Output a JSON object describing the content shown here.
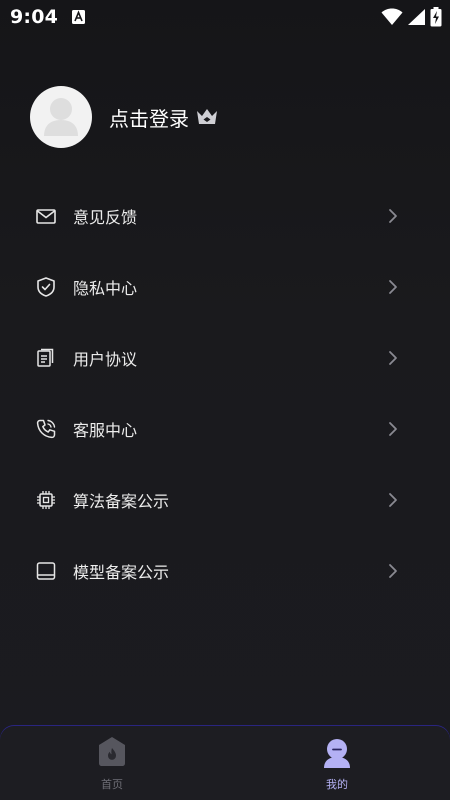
{
  "status_bar": {
    "time": "9:04",
    "notification_icon": "accessibility-a-icon",
    "icons": [
      "wifi-icon",
      "signal-icon",
      "battery-charging-icon"
    ]
  },
  "profile": {
    "login_label": "点击登录",
    "avatar_icon": "default-avatar-icon",
    "badge_icon": "crown-icon"
  },
  "menu": {
    "items": [
      {
        "label": "意见反馈",
        "icon": "mail-icon"
      },
      {
        "label": "隐私中心",
        "icon": "shield-check-icon"
      },
      {
        "label": "用户协议",
        "icon": "document-icon"
      },
      {
        "label": "客服中心",
        "icon": "phone-icon"
      },
      {
        "label": "算法备案公示",
        "icon": "chip-icon"
      },
      {
        "label": "模型备案公示",
        "icon": "tablet-icon"
      }
    ]
  },
  "tab_bar": {
    "tabs": [
      {
        "label": "首页",
        "icon": "home-flame-icon",
        "active": false
      },
      {
        "label": "我的",
        "icon": "user-icon",
        "active": true
      }
    ]
  },
  "colors": {
    "background": "#18181b",
    "text_primary": "#ffffff",
    "text_secondary": "#ececec",
    "icon_muted": "#8a8a92",
    "tab_active": "#b4b1f4",
    "tab_inactive": "#6e6e76"
  }
}
